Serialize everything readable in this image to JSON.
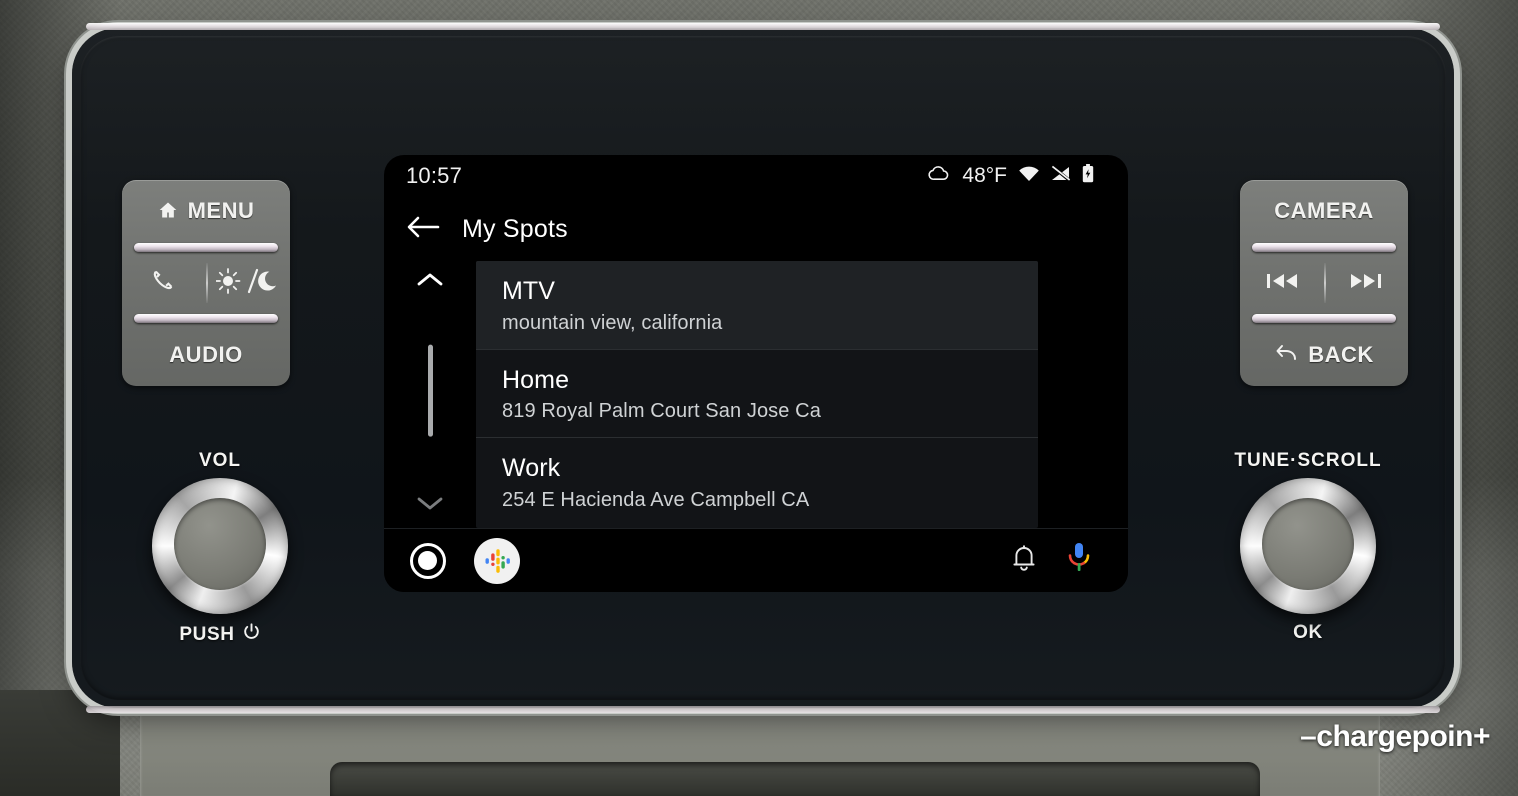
{
  "screen": {
    "status_bar": {
      "time": "10:57",
      "temperature": "48°F",
      "weather_icon": "cloud-icon",
      "wifi_icon": "wifi-icon",
      "cellular_icon": "cellular-off-icon",
      "battery_icon": "battery-icon"
    },
    "app_bar": {
      "back_icon": "back-arrow-icon",
      "title": "My Spots"
    },
    "scroll": {
      "up_icon": "chevron-up-icon",
      "down_icon": "chevron-down-icon"
    },
    "list": {
      "items": [
        {
          "title": "MTV",
          "subtitle": "mountain view, california",
          "selected": true
        },
        {
          "title": "Home",
          "subtitle": "819 Royal Palm Court San Jose Ca",
          "selected": false
        },
        {
          "title": "Work",
          "subtitle": "254 E Hacienda Ave Campbell CA",
          "selected": false
        }
      ]
    },
    "bottom_bar": {
      "home_icon": "home-circle-icon",
      "podcasts_icon": "google-podcasts-icon",
      "notifications_icon": "bell-icon",
      "assistant_icon": "google-assistant-mic-icon"
    }
  },
  "hardware": {
    "left_cluster": {
      "menu_label": "MENU",
      "menu_icon": "home-icon",
      "phone_icon": "phone-icon",
      "display_icon": "brightness-day-night-icon",
      "audio_label": "AUDIO"
    },
    "right_cluster": {
      "camera_label": "CAMERA",
      "prev_icon": "skip-previous-icon",
      "next_icon": "skip-next-icon",
      "back_label": "BACK",
      "back_icon": "back-curved-arrow-icon"
    },
    "volume_knob": {
      "top_label": "VOL",
      "bottom_label": "PUSH",
      "power_icon": "power-icon"
    },
    "tune_knob": {
      "top_label": "TUNE·SCROLL",
      "bottom_label": "OK"
    }
  },
  "watermark": {
    "text": "chargepoin",
    "prefix_dash": "–",
    "plus": "+"
  },
  "colors": {
    "screen_bg": "#000000",
    "card_bg": "#121417",
    "card_selected_bg": "#1f2225",
    "text_primary": "#ffffff",
    "text_secondary": "#cfd2d4",
    "divider": "#2b2e31",
    "google_blue": "#4285F4",
    "google_red": "#EA4335",
    "google_yellow": "#FBBC05",
    "google_green": "#34A853"
  }
}
